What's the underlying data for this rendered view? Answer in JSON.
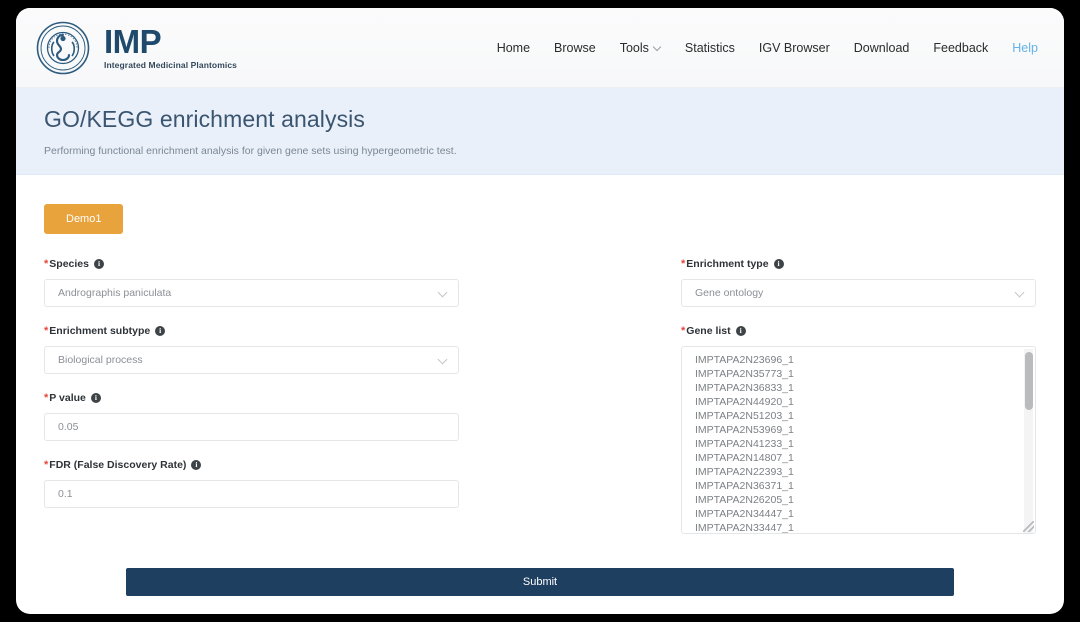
{
  "brand": {
    "title": "IMP",
    "subtitle": "Integrated Medicinal Plantomics",
    "emblem_icon": "circular-seal-logo-icon"
  },
  "nav": {
    "items": [
      {
        "label": "Home",
        "has_caret": false,
        "highlight": false
      },
      {
        "label": "Browse",
        "has_caret": false,
        "highlight": false
      },
      {
        "label": "Tools",
        "has_caret": true,
        "highlight": false
      },
      {
        "label": "Statistics",
        "has_caret": false,
        "highlight": false
      },
      {
        "label": "IGV Browser",
        "has_caret": false,
        "highlight": false
      },
      {
        "label": "Download",
        "has_caret": false,
        "highlight": false
      },
      {
        "label": "Feedback",
        "has_caret": false,
        "highlight": false
      },
      {
        "label": "Help",
        "has_caret": false,
        "highlight": true
      }
    ],
    "help_color": "#63b3e8"
  },
  "banner": {
    "title": "GO/KEGG enrichment analysis",
    "description": "Performing functional enrichment analysis for given gene sets using hypergeometric test.",
    "background": "#eaf0fa"
  },
  "demo": {
    "label": "Demo1",
    "color": "#e8a33d"
  },
  "form": {
    "required_marker": "*",
    "info_icon_glyph": "i",
    "species": {
      "label": "Species",
      "value": "Andrographis paniculata"
    },
    "enrichment_type": {
      "label": "Enrichment type",
      "value": "Gene ontology"
    },
    "enrichment_subtype": {
      "label": "Enrichment subtype",
      "value": "Biological process"
    },
    "p_value": {
      "label": "P value",
      "value": "0.05"
    },
    "fdr": {
      "label": "FDR (False Discovery Rate)",
      "value": "0.1"
    },
    "gene_list": {
      "label": "Gene list",
      "lines": [
        "IMPTAPA2N23696_1",
        "IMPTAPA2N35773_1",
        "IMPTAPA2N36833_1",
        "IMPTAPA2N44920_1",
        "IMPTAPA2N51203_1",
        "IMPTAPA2N53969_1",
        "IMPTAPA2N41233_1",
        "IMPTAPA2N14807_1",
        "IMPTAPA2N22393_1",
        "IMPTAPA2N36371_1",
        "IMPTAPA2N26205_1",
        "IMPTAPA2N34447_1",
        "IMPTAPA2N33447_1"
      ]
    }
  },
  "submit": {
    "label": "Submit",
    "color": "#1e3f5f"
  }
}
